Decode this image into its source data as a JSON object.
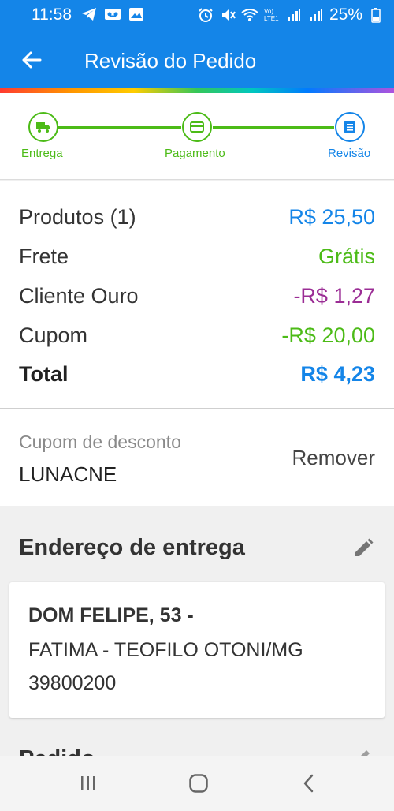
{
  "status_bar": {
    "time": "11:58",
    "battery": "25%",
    "left_icons": [
      "telegram-icon",
      "voicemail-icon",
      "image-icon"
    ],
    "right_icons": [
      "alarm-icon",
      "mute-icon",
      "wifi-icon",
      "volte-icon",
      "signal-icon",
      "signal-icon",
      "battery-icon"
    ]
  },
  "header": {
    "title": "Revisão do Pedido",
    "background": "#1485e8"
  },
  "stepper": {
    "steps": [
      {
        "label": "Entrega",
        "icon": "truck-icon",
        "state": "done"
      },
      {
        "label": "Pagamento",
        "icon": "card-icon",
        "state": "done"
      },
      {
        "label": "Revisão",
        "icon": "list-icon",
        "state": "active"
      }
    ],
    "colors": {
      "done": "#4cbb17",
      "active": "#1485e8"
    }
  },
  "summary": {
    "rows": [
      {
        "label": "Produtos (1)",
        "value": "R$ 25,50",
        "color": "#1485e8"
      },
      {
        "label": "Frete",
        "value": "Grátis",
        "color": "#4cbb17"
      },
      {
        "label": "Cliente Ouro",
        "value": "-R$ 1,27",
        "color": "#9b2d95"
      },
      {
        "label": "Cupom",
        "value": "-R$ 20,00",
        "color": "#4cbb17"
      }
    ],
    "total": {
      "label": "Total",
      "value": "R$ 4,23",
      "color": "#1485e8"
    }
  },
  "coupon": {
    "label": "Cupom de desconto",
    "code": "LUNACNE",
    "remove_label": "Remover"
  },
  "address": {
    "title": "Endereço de entrega",
    "line1": "DOM FELIPE, 53 -",
    "line2": "FATIMA - TEOFILO OTONI/MG",
    "line3": "39800200"
  },
  "next_section": {
    "title": "Pedido"
  }
}
